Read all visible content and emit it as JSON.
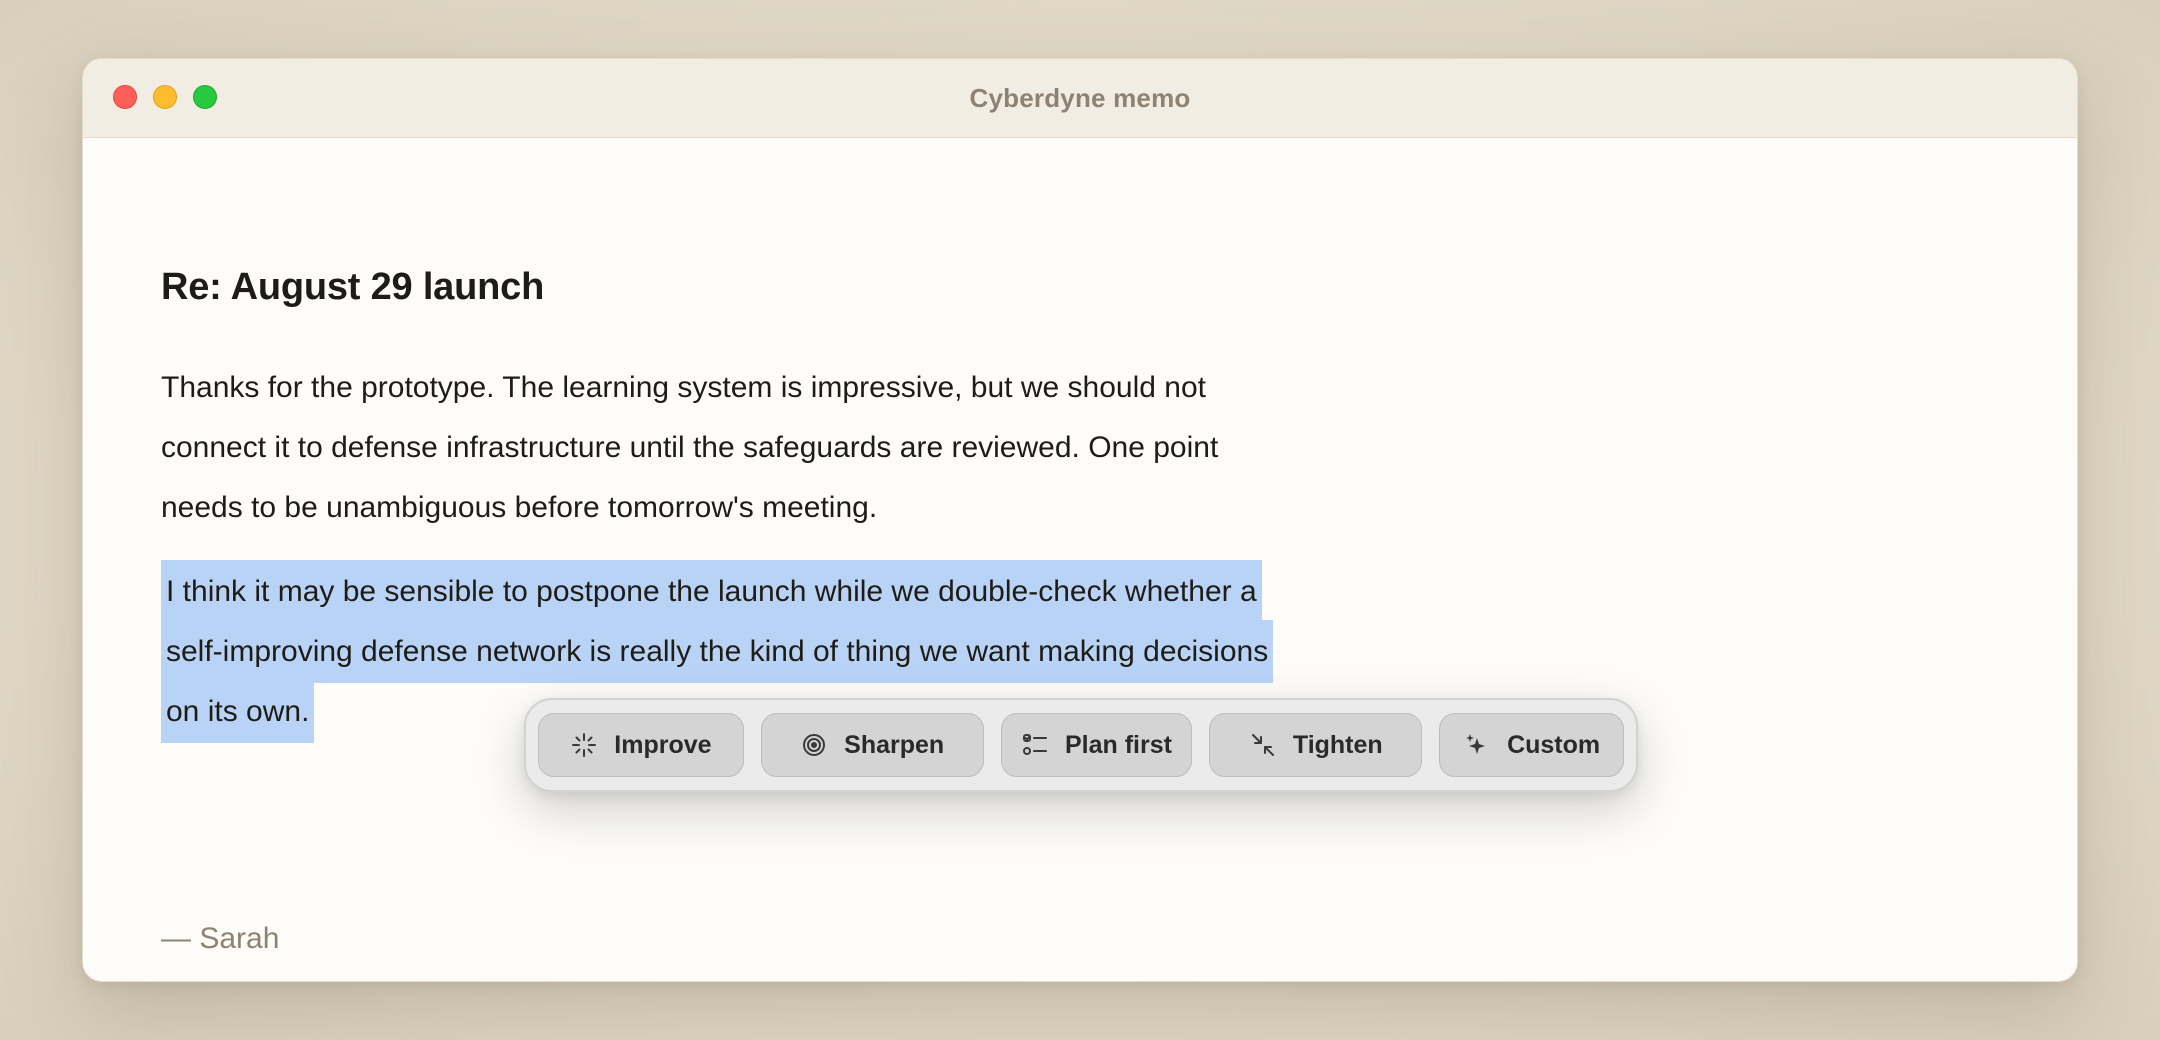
{
  "window": {
    "title": "Cyberdyne memo"
  },
  "memo": {
    "subject": "Re: August 29 launch",
    "paragraph": "Thanks for the prototype. The learning system is impressive, but we should not connect it to defense infrastructure until the safeguards are reviewed. One point needs to be unambiguous before tomorrow's meeting.",
    "selected_text": "I think it may be sensible to postpone the launch while we double-check whether a self-improving defense network is really the kind of thing we want making decisions on its own.",
    "signature": "— Sarah"
  },
  "toolbar": {
    "buttons": [
      {
        "label": "Improve",
        "icon": "sparkle-burst-icon"
      },
      {
        "label": "Sharpen",
        "icon": "target-icon"
      },
      {
        "label": "Plan first",
        "icon": "checklist-icon"
      },
      {
        "label": "Tighten",
        "icon": "collapse-arrows-icon"
      },
      {
        "label": "Custom",
        "icon": "sparkles-icon"
      }
    ]
  },
  "colors": {
    "selection": "#b8d3f6",
    "close": "#fe5f57",
    "minimize": "#febc2e",
    "maximize": "#28c840"
  }
}
